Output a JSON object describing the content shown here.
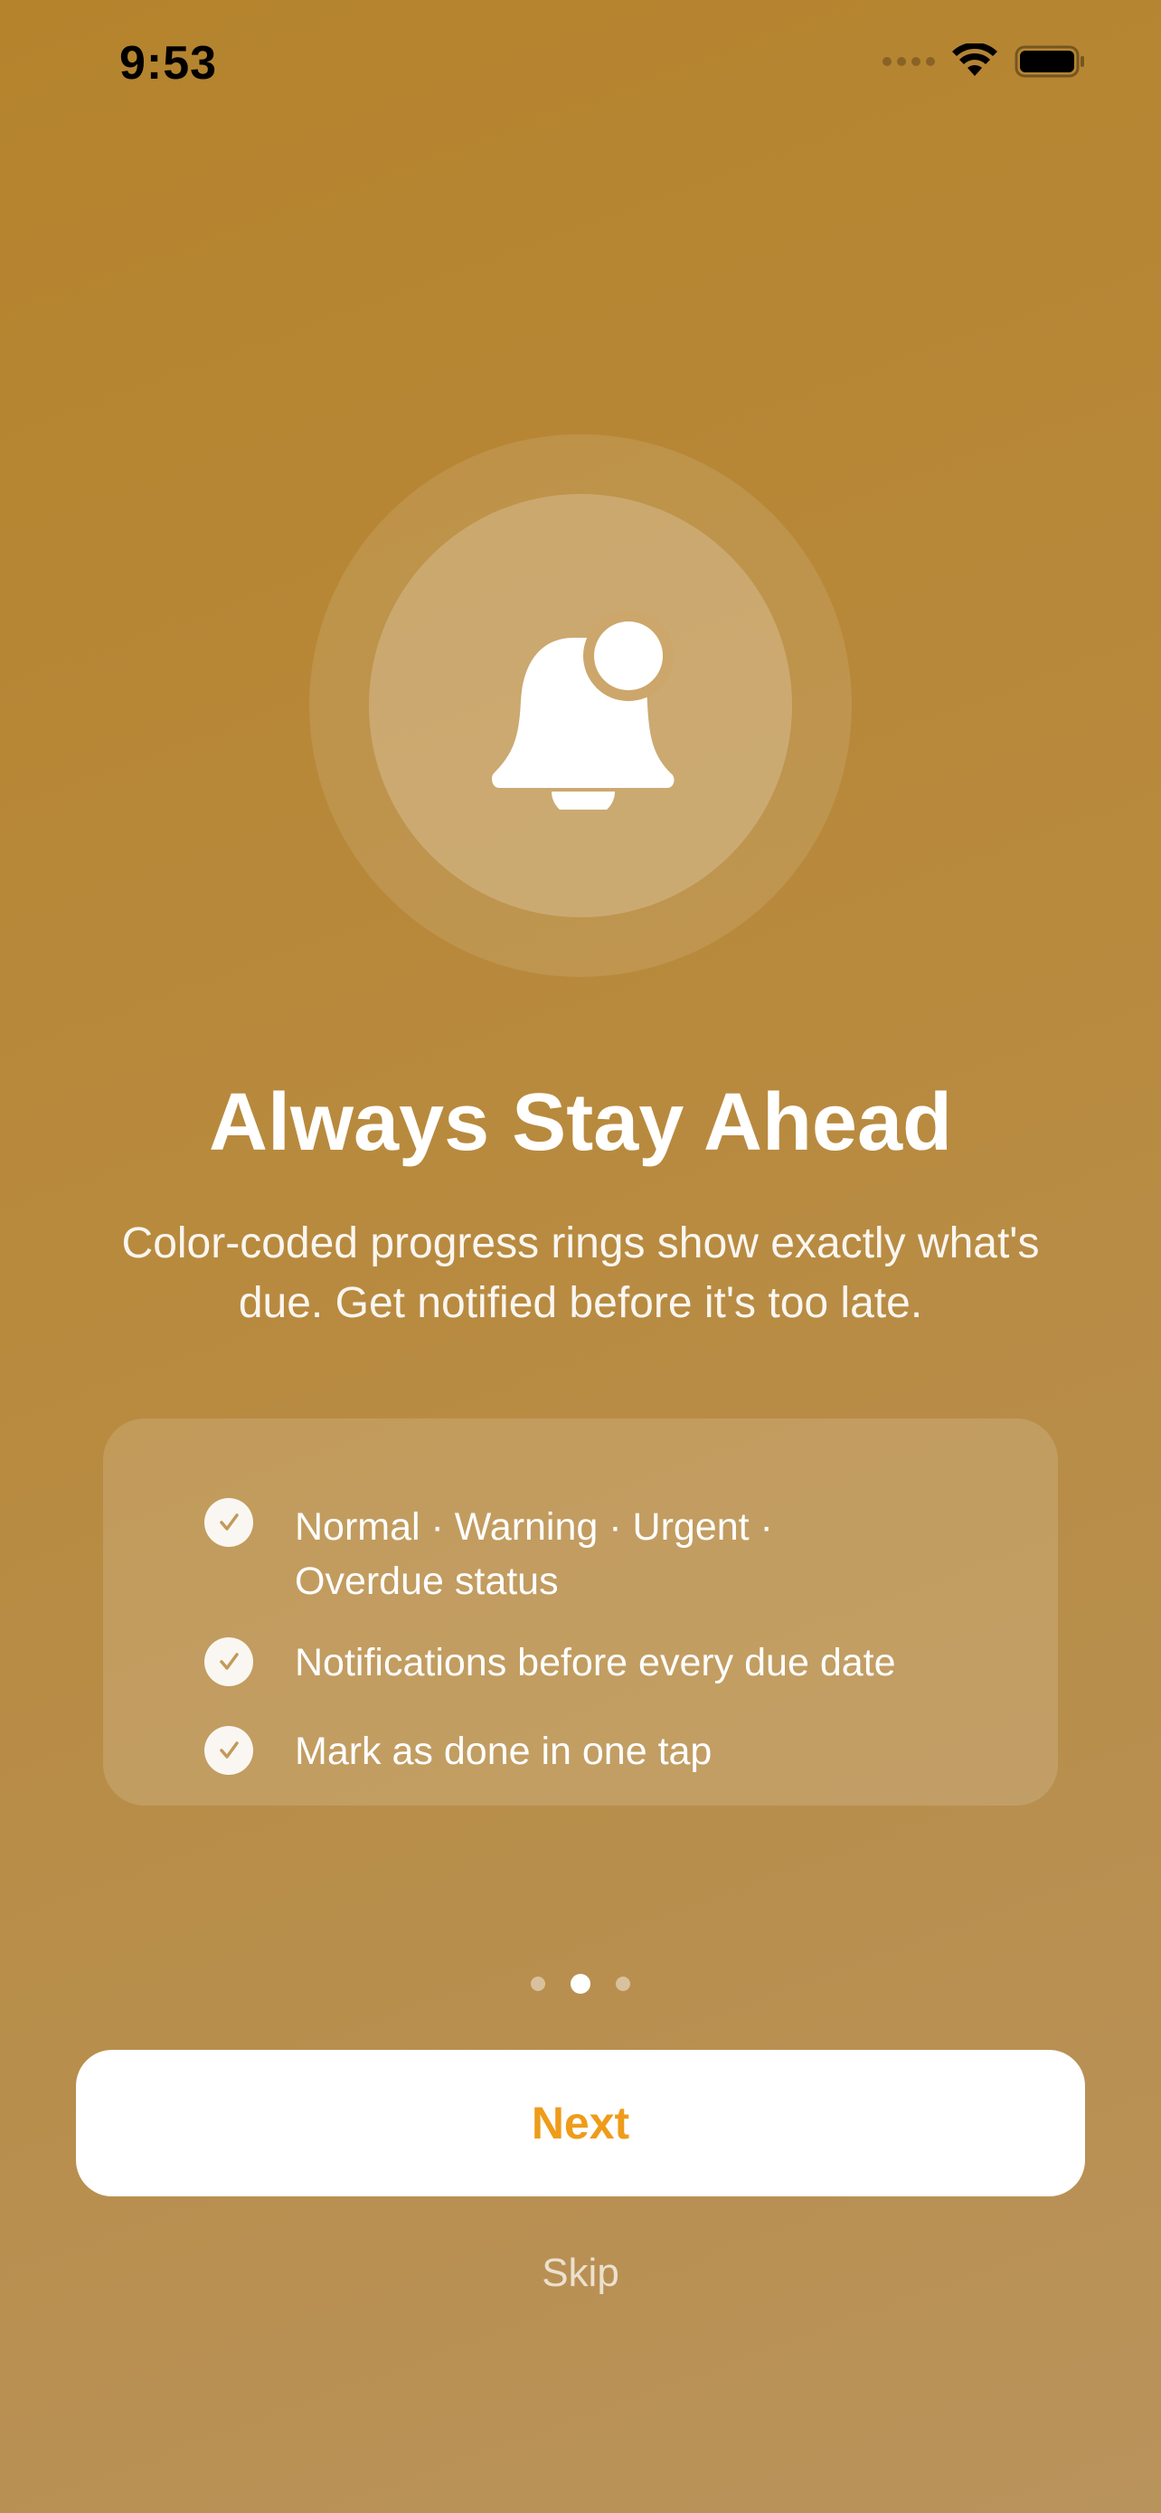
{
  "status_bar": {
    "time": "9:53"
  },
  "hero": {
    "icon": "bell-badge-icon"
  },
  "title": "Always Stay Ahead",
  "description": "Color-coded progress rings show exactly what's due. Get notified before it's too late.",
  "features": [
    {
      "text": "Normal · Warning · Urgent · Overdue status"
    },
    {
      "text": "Notifications before every due date"
    },
    {
      "text": "Mark as done in one tap"
    }
  ],
  "pagination": {
    "total": 3,
    "current": 2
  },
  "actions": {
    "next_label": "Next",
    "skip_label": "Skip"
  },
  "colors": {
    "background_top": "#b5832c",
    "background_bottom": "#b9935c",
    "accent": "#ee9c1a"
  }
}
